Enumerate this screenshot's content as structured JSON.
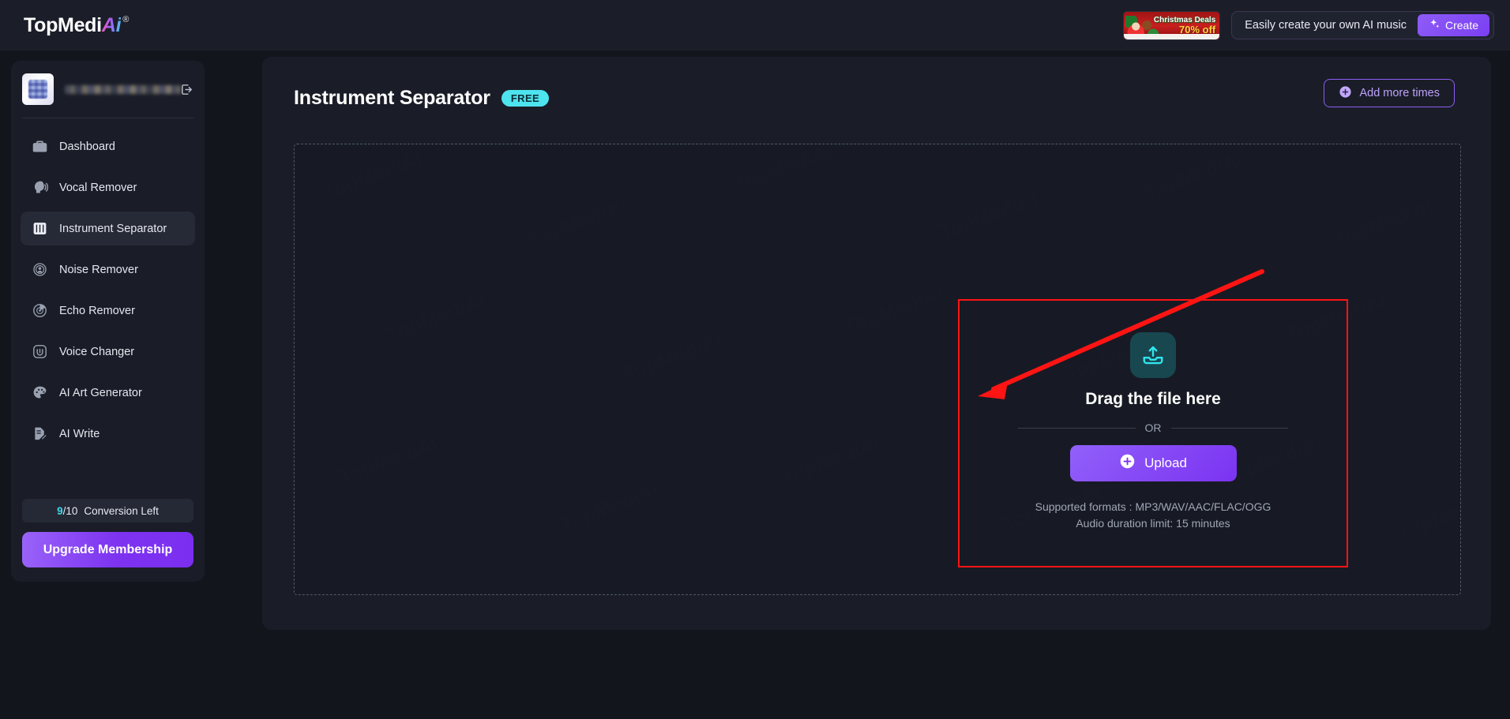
{
  "topbar": {
    "logo_main": "TopMedi",
    "logo_ai": "Ai",
    "logo_registered": "®",
    "xmas_line1": "Christmas Deals",
    "xmas_line2": "70% off",
    "promo_text": "Easily create your own AI music",
    "create_label": "Create",
    "create_icon": "sparkles-icon"
  },
  "sidebar": {
    "username": "",
    "logout_icon": "logout-icon",
    "items": [
      {
        "label": "Dashboard",
        "icon": "briefcase-icon",
        "active": false
      },
      {
        "label": "Vocal Remover",
        "icon": "head-soundwave-icon",
        "active": false
      },
      {
        "label": "Instrument Separator",
        "icon": "piano-keys-icon",
        "active": true
      },
      {
        "label": "Noise Remover",
        "icon": "noise-person-icon",
        "active": false
      },
      {
        "label": "Echo Remover",
        "icon": "echo-radar-icon",
        "active": false
      },
      {
        "label": "Voice Changer",
        "icon": "voice-changer-icon",
        "active": false
      },
      {
        "label": "AI Art Generator",
        "icon": "palette-icon",
        "active": false
      },
      {
        "label": "AI Write",
        "icon": "document-pen-icon",
        "active": false
      }
    ],
    "conversion_used": "9",
    "conversion_sep": "/10",
    "conversion_label": "Conversion Left",
    "upgrade_label": "Upgrade Membership"
  },
  "main": {
    "page_title": "Instrument Separator",
    "free_badge": "FREE",
    "add_more_times": "Add more times",
    "add_more_icon": "plus-circle-icon",
    "dropzone": {
      "upload_icon": "upload-tray-icon",
      "drag_title": "Drag the file here",
      "or_text": "OR",
      "upload_button": "Upload",
      "upload_button_icon": "plus-circle-icon",
      "supported_formats": "Supported formats : MP3/WAV/AAC/FLAC/OGG",
      "duration_limit": "Audio duration limit: 15 minutes"
    }
  },
  "annotations": {
    "highlight_box_color": "#ff1414",
    "arrow_color": "#ff1414",
    "arrow_target": "upload-button"
  },
  "colors": {
    "page_bg": "#13151d",
    "panel_bg": "#1a1d27",
    "accent_purple": "#7d33f0",
    "accent_cyan": "#4de3ef",
    "text_primary": "#ffffff",
    "text_muted": "#9fa6b6"
  }
}
